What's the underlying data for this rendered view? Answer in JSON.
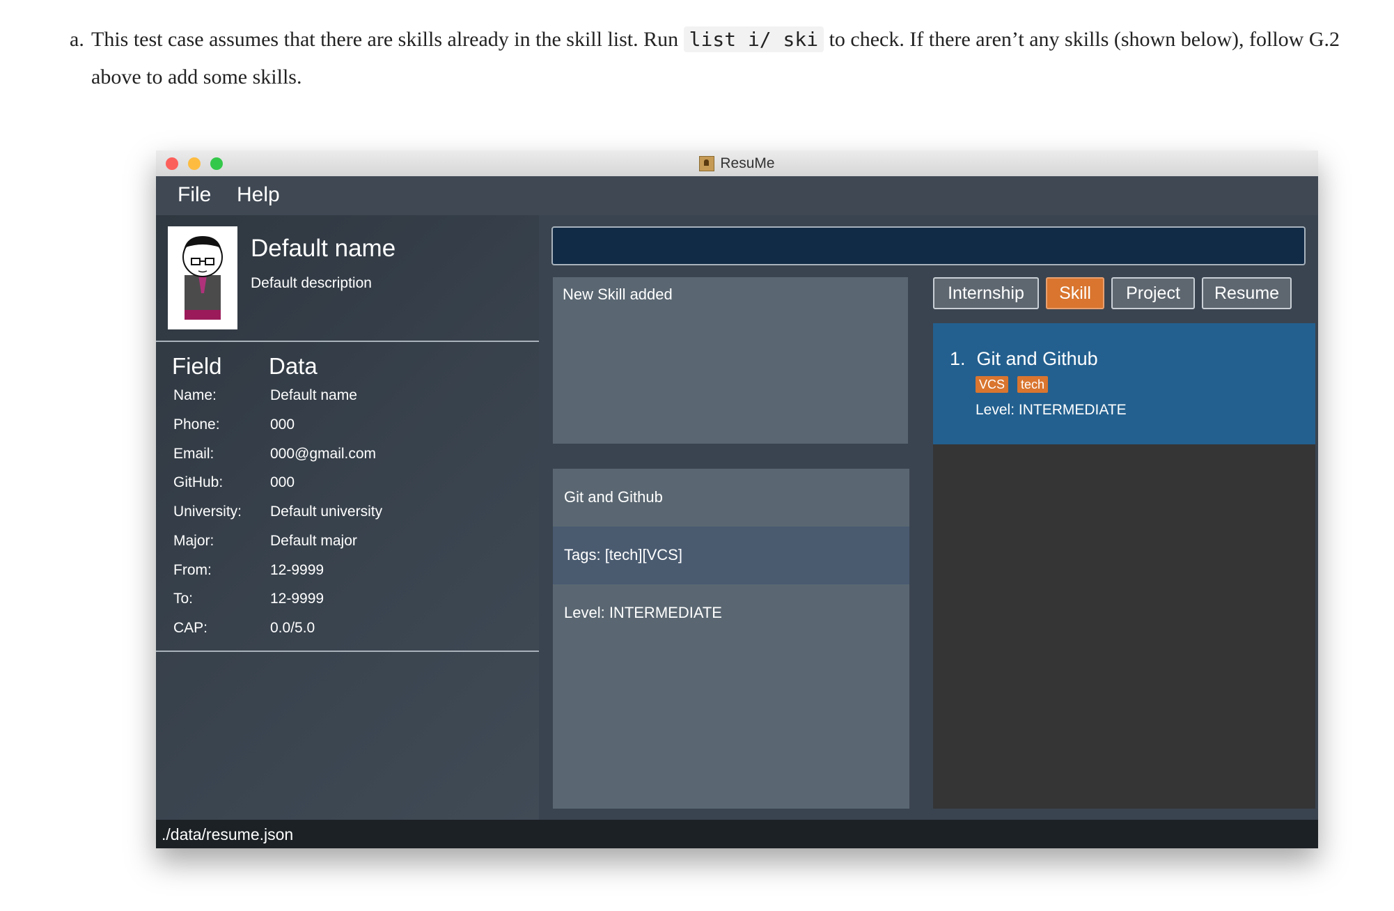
{
  "doc": {
    "marker": "a.",
    "text_before": "This test case assumes that there are skills already in the skill list. Run ",
    "code": "list i/ ski",
    "text_after": " to check. If there aren’t any skills (shown below), follow G.2 above to add some skills."
  },
  "window": {
    "title": "ResuMe",
    "title_icon": "app-person-icon"
  },
  "menu": {
    "file": "File",
    "help": "Help"
  },
  "profile": {
    "name": "Default name",
    "description": "Default description",
    "avatar_icon": "cartoon-avatar-icon"
  },
  "table": {
    "header_field": "Field",
    "header_data": "Data",
    "rows": [
      {
        "label": "Name:",
        "value": "Default name"
      },
      {
        "label": "Phone:",
        "value": "000"
      },
      {
        "label": "Email:",
        "value": "000@gmail.com"
      },
      {
        "label": "GitHub:",
        "value": "000"
      },
      {
        "label": "University:",
        "value": "Default university"
      },
      {
        "label": "Major:",
        "value": "Default major"
      },
      {
        "label": "From:",
        "value": "12-9999"
      },
      {
        "label": "To:",
        "value": "12-9999"
      },
      {
        "label": "CAP:",
        "value": "0.0/5.0"
      }
    ]
  },
  "command": {
    "value": ""
  },
  "result": {
    "text": "New Skill added"
  },
  "detail": {
    "title": "Git and Github",
    "tags": "Tags: [tech][VCS]",
    "level": "Level: INTERMEDIATE"
  },
  "tabs": [
    {
      "label": "Internship",
      "active": false
    },
    {
      "label": "Skill",
      "active": true
    },
    {
      "label": "Project",
      "active": false
    },
    {
      "label": "Resume",
      "active": false
    }
  ],
  "list": {
    "items": [
      {
        "index": "1.",
        "title": "Git and Github",
        "tags": [
          "VCS",
          "tech"
        ],
        "level": "Level: INTERMEDIATE"
      }
    ]
  },
  "status": {
    "path": "./data/resume.json"
  },
  "colors": {
    "accent_orange": "#d9752f",
    "selected_blue": "#23608f",
    "command_bg": "#112a46"
  }
}
